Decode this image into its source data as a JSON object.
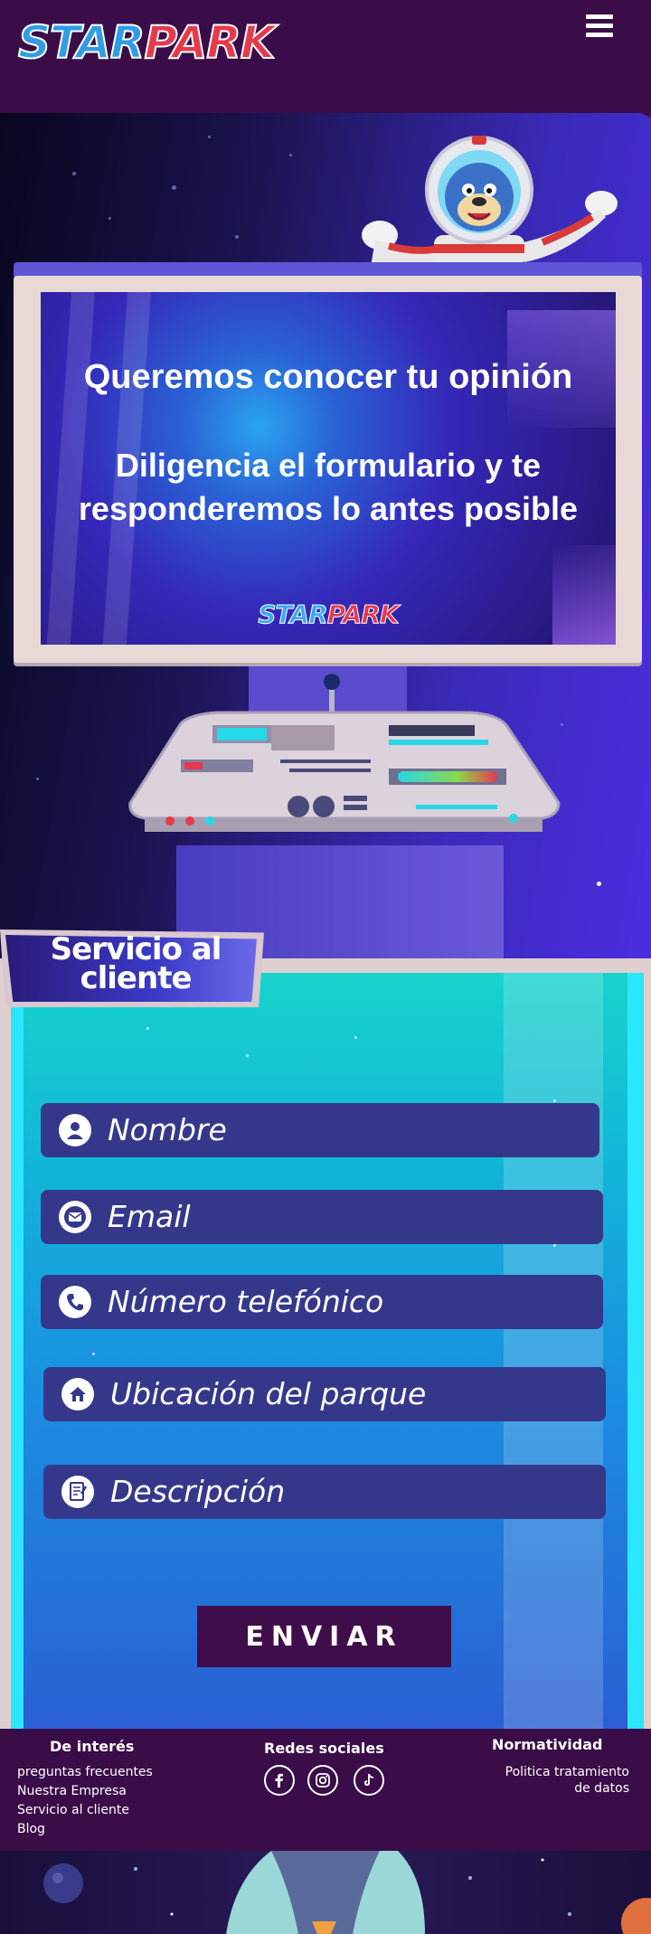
{
  "brand": {
    "logo_star": "STAR",
    "logo_park": "PARK"
  },
  "screen": {
    "title": "Queremos conocer tu opinión",
    "subtitle": "Diligencia el formulario y te responderemos lo antes posible",
    "logo_star": "STAR",
    "logo_park": "PARK"
  },
  "service": {
    "title_line1": "Servicio al",
    "title_line2": "cliente"
  },
  "form": {
    "fields": [
      {
        "label": "Nombre",
        "icon": "user-icon"
      },
      {
        "label": "Email",
        "icon": "envelope-icon"
      },
      {
        "label": "Número telefónico",
        "icon": "phone-icon"
      },
      {
        "label": "Ubicación del parque",
        "icon": "home-icon"
      },
      {
        "label": "Descripción",
        "icon": "document-icon"
      }
    ],
    "submit_label": "ENVIAR"
  },
  "footer": {
    "interest_title": "De interés",
    "interest_links": [
      "preguntas frecuentes",
      "Nuestra Empresa",
      "Servicio al cliente",
      "Blog"
    ],
    "social_title": "Redes sociales",
    "social_icons": [
      "facebook-icon",
      "instagram-icon",
      "tiktok-icon"
    ],
    "legal_title": "Normatividad",
    "legal_link_line1": "Politica tratamiento",
    "legal_link_line2": "de datos"
  },
  "colors": {
    "header_bg": "#3a0c48",
    "field_bg": "#35388a",
    "submit_bg": "#3f0d4a",
    "accent_cyan": "#2ae6ff"
  }
}
